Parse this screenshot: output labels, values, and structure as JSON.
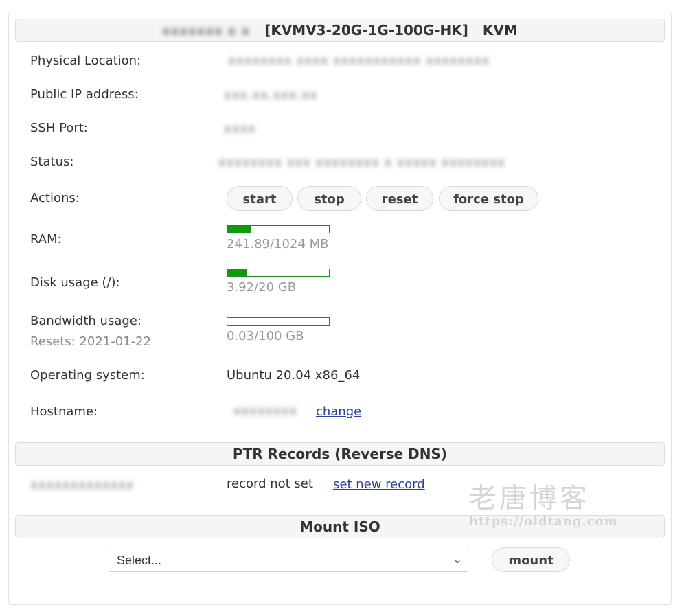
{
  "header": {
    "hidden_name": "xxxxxxx x x",
    "plan": "[KVMV3-20G-1G-100G-HK]",
    "type": "KVM"
  },
  "fields": {
    "physical_location": {
      "label": "Physical Location:",
      "value": "xxxxxxxx xxxx xxxxxxxxxxx xxxxxxxx"
    },
    "public_ip": {
      "label": "Public IP address:",
      "value": "xxx.xx.xxx.xx"
    },
    "ssh_port": {
      "label": "SSH Port:",
      "value": "xxxx"
    },
    "status": {
      "label": "Status:",
      "value": "xxxxxxxx xxx xxxxxxxx x xxxxx xxxxxxxx"
    },
    "actions": {
      "label": "Actions:",
      "buttons": [
        "start",
        "stop",
        "reset",
        "force stop"
      ]
    },
    "ram": {
      "label": "RAM:",
      "text": "241.89/1024 MB",
      "used": 241.89,
      "total": 1024
    },
    "disk": {
      "label": "Disk usage (/):",
      "text": "3.92/20 GB",
      "used": 3.92,
      "total": 20
    },
    "bandwidth": {
      "label": "Bandwidth usage:",
      "resets": "Resets: 2021-01-22",
      "text": "0.03/100 GB",
      "used": 0.03,
      "total": 100
    },
    "os": {
      "label": "Operating system:",
      "value": "Ubuntu 20.04 x86_64"
    },
    "hostname": {
      "label": "Hostname:",
      "value": "xxxxxxxx",
      "change": "change"
    }
  },
  "ptr": {
    "title": "PTR Records (Reverse DNS)",
    "ip": "xxxxxxxxxxxxx",
    "status": "record not set",
    "link": "set new record"
  },
  "iso": {
    "title": "Mount ISO",
    "select_value": "Select...",
    "mount": "mount"
  },
  "watermark": {
    "cn": "老唐博客",
    "url": "https://oldtang.com"
  }
}
